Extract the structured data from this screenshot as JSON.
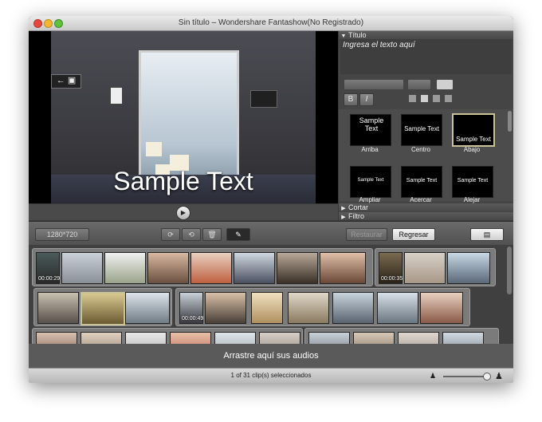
{
  "window": {
    "title": "Sin título – Wondershare Fantashow(No Registrado)"
  },
  "preview": {
    "overlay_text": "Sample Text"
  },
  "panel": {
    "title_section": "Título",
    "text_placeholder": "Ingresa el texto aquí",
    "bold_label": "B",
    "italic_label": "I",
    "position_presets": [
      {
        "label": "Arriba",
        "sample": "Sample Text"
      },
      {
        "label": "Centro",
        "sample": "Sample Text"
      },
      {
        "label": "Abajo",
        "sample": "Sample Text"
      }
    ],
    "motion_presets": [
      {
        "label": "Ampliar",
        "sample": "Sample Text"
      },
      {
        "label": "Acercar",
        "sample": "Sample Text"
      },
      {
        "label": "Alejar",
        "sample": "Sample Text"
      }
    ],
    "cut_section": "Cortar",
    "filter_section": "Filtro"
  },
  "toolbar": {
    "resolution": "1280*720",
    "restore_label": "Restaurar",
    "back_label": "Regresar"
  },
  "timeline": {
    "clip_times": [
      "00:00:29",
      "00:00:35",
      "00:00:49"
    ]
  },
  "audio": {
    "drop_text": "Arrastre aquí sus audios"
  },
  "status": {
    "text": "1 of 31 clip(s) seleccionados"
  },
  "colors": {
    "selected_preset_border": "#c9c297"
  },
  "icons": [
    "close-light",
    "minimize-light",
    "zoom-light",
    "play-icon",
    "rotate-right-icon",
    "rotate-left-icon",
    "trash-icon",
    "pencil-icon",
    "export-icon",
    "person-small-icon",
    "person-large-icon"
  ]
}
